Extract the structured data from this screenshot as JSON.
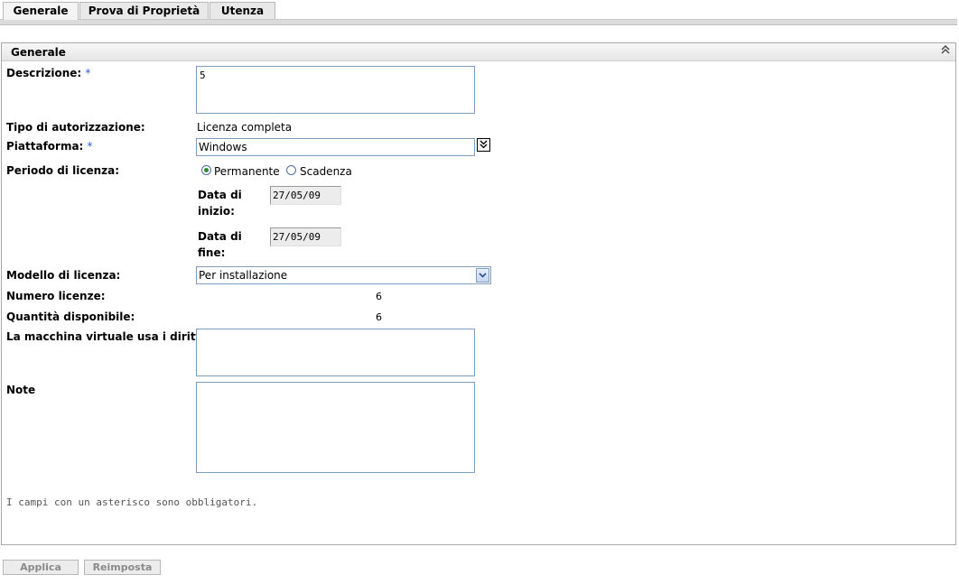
{
  "tabs": [
    {
      "label": "Generale",
      "active": true
    },
    {
      "label": "Prova di Proprietà",
      "active": false
    },
    {
      "label": "Utenza",
      "active": false
    }
  ],
  "panel": {
    "title": "Generale",
    "collapse_icon": "double-chevron-up-icon"
  },
  "form": {
    "descrizione": {
      "label": "Descrizione:",
      "required": "*",
      "value": "5"
    },
    "tipo": {
      "label": "Tipo di autorizzazione:",
      "value": "Licenza completa"
    },
    "piattaforma": {
      "label": "Piattaforma:",
      "required": "*",
      "value": "Windows",
      "button_icon": "double-chevron-down-icon"
    },
    "periodo": {
      "label": "Periodo di licenza:",
      "option_permanente": "Permanente",
      "option_scadenza": "Scadenza",
      "selected": "Permanente"
    },
    "data_inizio": {
      "label_line1": "Data di",
      "label_line2": "inizio:",
      "value": "27/05/09"
    },
    "data_fine": {
      "label_line1": "Data di",
      "label_line2": "fine:",
      "value": "27/05/09"
    },
    "modello": {
      "label": "Modello di licenza:",
      "value": "Per installazione"
    },
    "numero_licenze": {
      "label": "Numero licenze:",
      "value": "6"
    },
    "quantita": {
      "label": "Quantità disponibile:",
      "value": "6"
    },
    "macchina_virtuale": {
      "label": "La macchina virtuale usa i diritti:",
      "value": ""
    },
    "note": {
      "label": "Note",
      "value": ""
    }
  },
  "required_note": "I campi con un asterisco sono obbligatori.",
  "buttons": {
    "apply": "Applica",
    "reset": "Reimposta"
  },
  "colors": {
    "required_asterisk": "#2a5bd7",
    "radio_selected": "#2e8b2e",
    "disabled_button_text": "#8a8a8a"
  }
}
